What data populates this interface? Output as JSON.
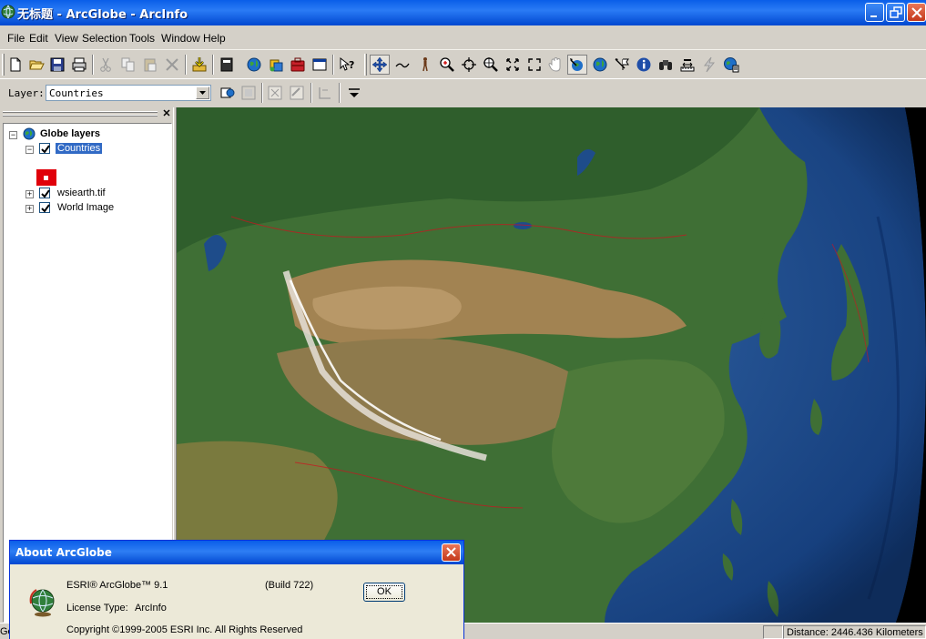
{
  "window": {
    "title": "无标题 - ArcGlobe - ArcInfo"
  },
  "menu": [
    {
      "label": "File"
    },
    {
      "label": "Edit"
    },
    {
      "label": "View"
    },
    {
      "label": "Selection"
    },
    {
      "label": "Tools"
    },
    {
      "label": "Window"
    },
    {
      "label": "Help"
    }
  ],
  "toolbar": {
    "icons": [
      "new-icon",
      "open-icon",
      "save-icon",
      "print-icon",
      "cut-icon",
      "copy-icon",
      "paste-icon",
      "delete-icon",
      "add-data-icon",
      "calculator-icon",
      "globe-icon",
      "layers-icon",
      "toolbox-icon",
      "window-icon",
      "whats-this-icon",
      "navigate-icon",
      "fly-icon",
      "walk-icon",
      "zoom-in-out-icon",
      "target-icon",
      "zoom-to-icon",
      "full-extent-icon",
      "fixed-zoom-icon",
      "pan-icon",
      "spin-icon",
      "globe-view-icon",
      "flag-icon",
      "identify-icon",
      "find-icon",
      "measure-icon",
      "flash-icon",
      "globe-settings-icon"
    ]
  },
  "layer_bar": {
    "label": "Layer:",
    "selected": "Countries"
  },
  "toc": {
    "root_label": "Globe layers",
    "layers": [
      {
        "label": "Countries",
        "checked": true,
        "expanded": true,
        "selected": true,
        "symbol_color": "#e0000a"
      },
      {
        "label": "wsiearth.tif",
        "checked": true,
        "expanded": false,
        "selected": false
      },
      {
        "label": "World Image",
        "checked": true,
        "expanded": false,
        "selected": false
      }
    ]
  },
  "status": {
    "left_text": "Ge",
    "distance": "Distance:  2446.436 Kilometers"
  },
  "about_dialog": {
    "title": "About ArcGlobe",
    "product": "ESRI® ArcGlobe™  9.1",
    "build": "(Build 722)",
    "license_label": "License Type:",
    "license_value": "ArcInfo",
    "copyright": "Copyright ©1999-2005 ESRI Inc. All Rights Reserved",
    "ok_label": "OK"
  },
  "colors": {
    "title_bar": "#0a5ee8",
    "selection": "#316ac5",
    "ocean": "#1f4e8f",
    "land_green": "#3f7a38",
    "desert": "#a88858"
  }
}
